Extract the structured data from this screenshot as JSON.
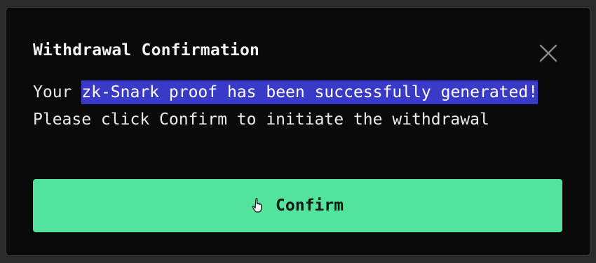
{
  "modal": {
    "title": "Withdrawal Confirmation",
    "message_prefix": "Your ",
    "message_highlight": "zk-Snark proof has been successfully generated!",
    "message_suffix": " Please click Confirm to initiate the withdrawal",
    "close_icon": "close-icon",
    "confirm_label": "Confirm",
    "cursor_icon": "hand-cursor-icon"
  },
  "colors": {
    "modal_background": "#0a0a0a",
    "text": "#eaeaea",
    "selection_highlight": "#3a3ac8",
    "confirm_button": "#52e39c"
  }
}
